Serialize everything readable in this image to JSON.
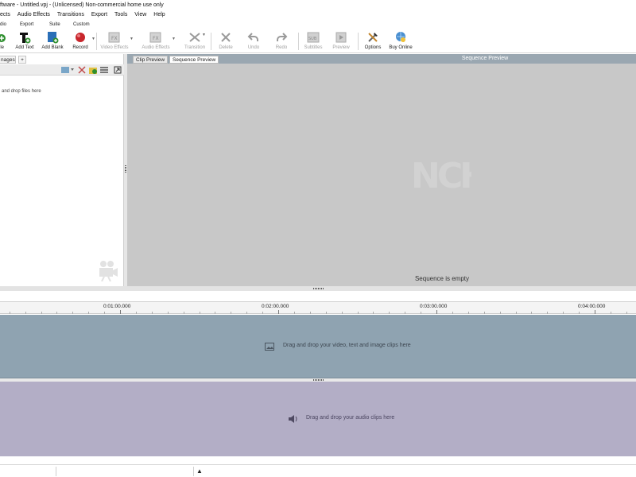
{
  "window": {
    "title": "ftware - Untitled.vpj - (Unlicensed) Non-commercial home use only"
  },
  "menu": [
    "ects",
    "Audio Effects",
    "Transitions",
    "Export",
    "Tools",
    "View",
    "Help"
  ],
  "ribbon_tabs": [
    "dio",
    "Export",
    "Suite",
    "Custom"
  ],
  "toolbar": {
    "buttons": [
      {
        "label": "ile",
        "icon": "add-file-icon",
        "enabled": true
      },
      {
        "label": "Add Text",
        "icon": "text-icon",
        "enabled": true
      },
      {
        "label": "Add Blank",
        "icon": "blank-icon",
        "enabled": true
      },
      {
        "label": "Record",
        "icon": "record-icon",
        "enabled": true
      },
      {
        "label": "Video Effects",
        "icon": "fx-icon",
        "enabled": false
      },
      {
        "label": "Audio Effects",
        "icon": "audio-fx-icon",
        "enabled": false
      },
      {
        "label": "Transition",
        "icon": "transition-icon",
        "enabled": false
      },
      {
        "label": "Delete",
        "icon": "delete-icon",
        "enabled": false
      },
      {
        "label": "Undo",
        "icon": "undo-icon",
        "enabled": false
      },
      {
        "label": "Redo",
        "icon": "redo-icon",
        "enabled": false
      },
      {
        "label": "Subtitles",
        "icon": "subtitles-icon",
        "enabled": false
      },
      {
        "label": "Preview",
        "icon": "preview-icon",
        "enabled": false
      },
      {
        "label": "Options",
        "icon": "options-icon",
        "enabled": true
      },
      {
        "label": "Buy Online",
        "icon": "buy-online-icon",
        "enabled": true
      }
    ]
  },
  "left_panel": {
    "tab_label": "nages",
    "add_tab_label": "+",
    "hint": "and drop files here"
  },
  "preview": {
    "tabs": [
      "Clip Preview",
      "Sequence Preview"
    ],
    "active_tab": "Sequence Preview",
    "title": "Sequence Preview",
    "watermark": "NCH",
    "empty_message": "Sequence is empty"
  },
  "timeline": {
    "ruler_labels": [
      "0:01:00.000",
      "0:02:00.000",
      "0:03:00.000",
      "0:04:00.000"
    ],
    "video_hint": "Drag and drop your video, text and image clips here",
    "audio_hint": "Drag and drop your audio clips here"
  },
  "colors": {
    "video_track": "#8fa3b1",
    "audio_track": "#b3aec6",
    "preview_bg": "#c8c8c8",
    "preview_header": "#9aa7b1",
    "record_red": "#c8262c"
  }
}
